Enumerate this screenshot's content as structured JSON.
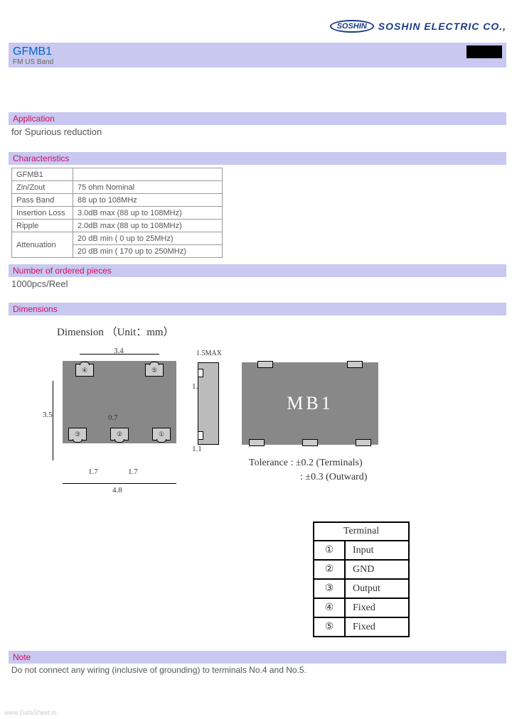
{
  "header": {
    "logo_text": "SOSHIN",
    "company": "SOSHIN ELECTRIC CO.,"
  },
  "title": {
    "part_number": "GFMB1",
    "description": "FM US Band"
  },
  "sections": {
    "application": {
      "heading": "Application",
      "text": "for Spurious reduction"
    },
    "characteristics": {
      "heading": "Characteristics",
      "part": "GFMB1",
      "rows": [
        {
          "param": "Zin/Zout",
          "value": "75 ohm Nominal"
        },
        {
          "param": "Pass Band",
          "value": "88 up to 108MHz"
        },
        {
          "param": "Insertion Loss",
          "value": "3.0dB max (88 up to 108MHz)"
        },
        {
          "param": "Ripple",
          "value": "2.0dB max (88 up to 108MHz)"
        },
        {
          "param": "Attenuation",
          "value": "20 dB min ( 0 up to 25MHz)"
        },
        {
          "param": "",
          "value": "20 dB min ( 170 up to 250MHz)"
        }
      ]
    },
    "ordered": {
      "heading": "Number of ordered pieces",
      "text": "1000pcs/Reel"
    },
    "dimensions": {
      "heading": "Dimensions",
      "title": "Dimension （Unit：mm）",
      "d34": "3.4",
      "d35": "3.5",
      "d11": "1.1",
      "d07": "0.7",
      "d17": "1.7",
      "d48": "4.8",
      "d15": "1.5MAX",
      "mark": "MB1",
      "tolerance1": "Tolerance : ±0.2 (Terminals)",
      "tolerance2": ": ±0.3 (Outward)",
      "pads": {
        "p1": "①",
        "p2": "②",
        "p3": "③",
        "p4": "④",
        "p5": "⑤"
      }
    },
    "terminals": {
      "heading": "Terminal",
      "rows": [
        {
          "num": "①",
          "name": "Input"
        },
        {
          "num": "②",
          "name": "GND"
        },
        {
          "num": "③",
          "name": "Output"
        },
        {
          "num": "④",
          "name": "Fixed"
        },
        {
          "num": "⑤",
          "name": "Fixed"
        }
      ]
    },
    "note": {
      "heading": "Note",
      "text": "Do not connect any wiring (inclusive of grounding) to terminals No.4 and No.5."
    }
  },
  "watermark": "www.DataSheet.in"
}
